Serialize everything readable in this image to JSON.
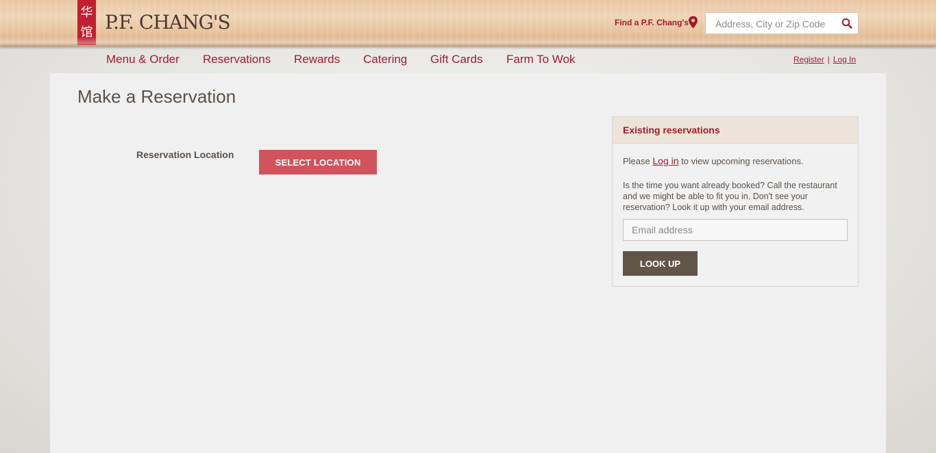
{
  "brand": {
    "logo_mark_chars": [
      "华",
      "馆"
    ],
    "logo_text": "P.F. CHANG'S",
    "accent_color": "#a11c2b",
    "logo_red": "#c0202f"
  },
  "header": {
    "find_label": "Find a P.F. Chang's",
    "find_icon": "map-pin-icon",
    "search_placeholder": "Address, City or Zip Code",
    "search_icon": "search-icon"
  },
  "nav": {
    "items": [
      {
        "label": "Menu & Order"
      },
      {
        "label": "Reservations"
      },
      {
        "label": "Rewards"
      },
      {
        "label": "Catering"
      },
      {
        "label": "Gift Cards"
      },
      {
        "label": "Farm To Wok"
      }
    ],
    "register_label": "Register",
    "separator": "|",
    "login_label": "Log In"
  },
  "main": {
    "title": "Make a Reservation",
    "location_label": "Reservation Location",
    "select_location_label": "SELECT LOCATION",
    "select_button_color": "#d2535c"
  },
  "existing": {
    "heading": "Existing reservations",
    "please_prefix": "Please ",
    "login_link": "Log in",
    "please_suffix": " to view upcoming reservations.",
    "help_text": "Is the time you want already booked? Call the restaurant and we might be able to fit you in.  Don't see your reservation? Look it up with your email address.",
    "email_placeholder": "Email address",
    "lookup_label": "LOOK UP",
    "lookup_button_color": "#625649"
  }
}
